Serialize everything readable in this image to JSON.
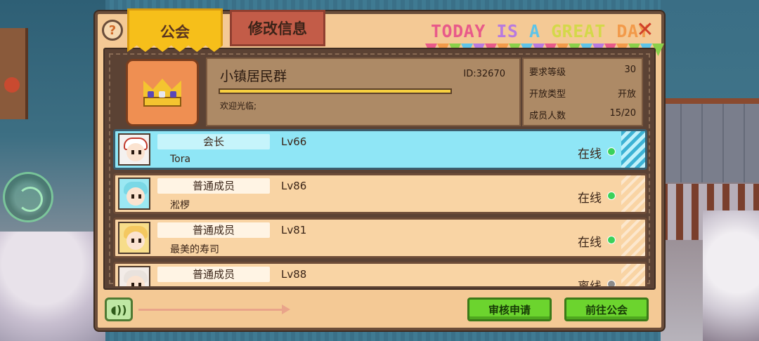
{
  "tabs": {
    "guild": "公会",
    "edit": "修改信息"
  },
  "banner": {
    "words": [
      {
        "text": "TODAY",
        "color": "#e85a8a"
      },
      {
        "text": " IS ",
        "color": "#b77ae0"
      },
      {
        "text": "A ",
        "color": "#5ec4e8"
      },
      {
        "text": "GREAT ",
        "color": "#d4d84a"
      },
      {
        "text": "DAY",
        "color": "#f29a4a"
      }
    ],
    "flag_colors": [
      "#e85a8a",
      "#f29a4a",
      "#8ad04a",
      "#5ec4e8",
      "#b77ae0",
      "#e85a8a",
      "#f29a4a",
      "#8ad04a",
      "#5ec4e8",
      "#b77ae0",
      "#e85a8a",
      "#f29a4a",
      "#8ad04a",
      "#5ec4e8",
      "#b77ae0",
      "#e85a8a",
      "#f29a4a",
      "#8ad04a",
      "#5ec4e8",
      "#8ad04a"
    ]
  },
  "help_icon": "?",
  "close_icon": "✕",
  "guild": {
    "name": "小镇居民群",
    "id": "ID:32670",
    "welcome": "欢迎光临;",
    "stats": [
      {
        "label": "要求等级",
        "value": "30"
      },
      {
        "label": "开放类型",
        "value": "开放"
      },
      {
        "label": "成员人数",
        "value": "15/20"
      }
    ]
  },
  "members": [
    {
      "role": "会长",
      "level": "Lv66",
      "name": "Tora",
      "status": "在线",
      "online": true,
      "leader": true,
      "avatar": "white"
    },
    {
      "role": "普通成员",
      "level": "Lv86",
      "name": "淞椤",
      "status": "在线",
      "online": true,
      "leader": false,
      "avatar": "cyan"
    },
    {
      "role": "普通成员",
      "level": "Lv81",
      "name": "最美的寿司",
      "status": "在线",
      "online": true,
      "leader": false,
      "avatar": "gold"
    },
    {
      "role": "普通成员",
      "level": "Lv88",
      "name": "",
      "status": "离线",
      "online": false,
      "leader": false,
      "avatar": "pale"
    }
  ],
  "buttons": {
    "review": "审核申请",
    "goto": "前往公会",
    "voice_icon": "◖))"
  }
}
